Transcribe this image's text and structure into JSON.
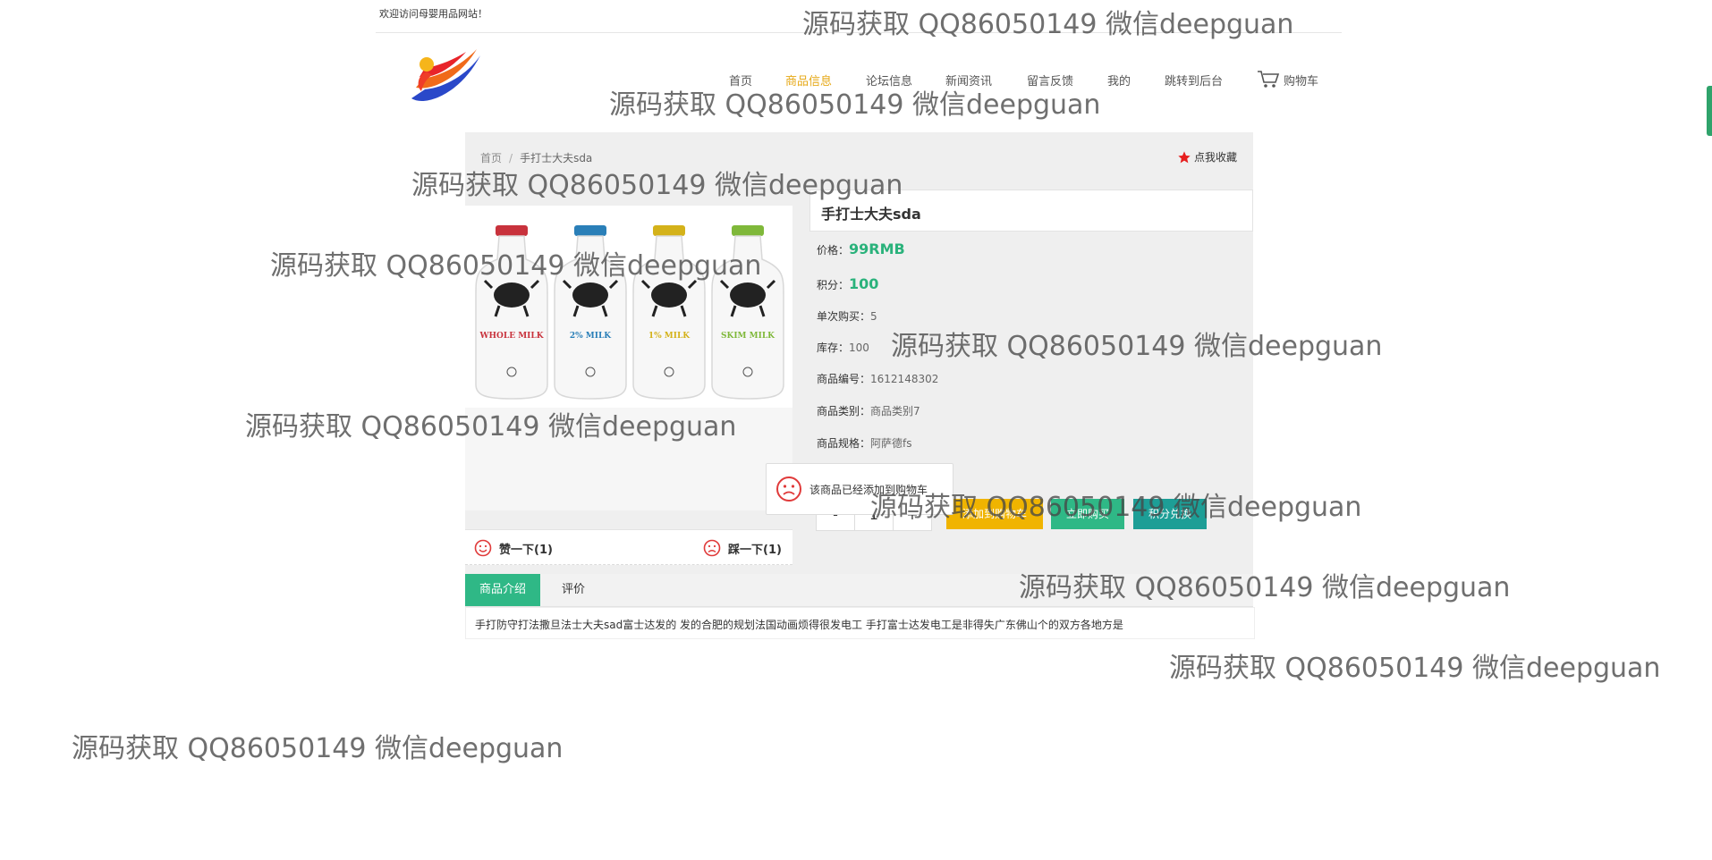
{
  "header": {
    "welcome": "欢迎访问母婴用品网站！"
  },
  "nav": {
    "items": [
      {
        "label": "首页"
      },
      {
        "label": "商品信息",
        "active": true
      },
      {
        "label": "论坛信息"
      },
      {
        "label": "新闻资讯"
      },
      {
        "label": "留言反馈"
      },
      {
        "label": "我的"
      },
      {
        "label": "跳转到后台"
      }
    ],
    "cart": "购物车"
  },
  "breadcrumb": {
    "home": "首页",
    "separator": "/",
    "current": "手打士大夫sda"
  },
  "favorite": "点我收藏",
  "product": {
    "name": "手打士大夫sda",
    "price_label": "价格：",
    "price": "99RMB",
    "points_label": "积分：",
    "points": "100",
    "limit_label": "单次购买：",
    "limit": "5",
    "stock_label": "库存：",
    "stock": "100",
    "code_label": "商品编号：",
    "code": "1612148302",
    "category_label": "商品类别：",
    "category": "商品类别7",
    "spec_label": "商品规格：",
    "spec": "阿萨德fs",
    "image_labels": [
      "WHOLE MILK",
      "2% MILK",
      "1% MILK",
      "SKIM MILK"
    ]
  },
  "quantity": {
    "minus": "-",
    "value": "1",
    "plus": "+"
  },
  "buttons": {
    "add_to_cart": "添加到购物车",
    "buy_now": "立即购买",
    "redeem": "积分兑换"
  },
  "toast": {
    "message": "该商品已经添加到购物车"
  },
  "votes": {
    "like": "赞一下(1)",
    "dislike": "踩一下(1)"
  },
  "tabs": {
    "intro": "商品介绍",
    "reviews": "评价"
  },
  "description": "手打防守打法撒旦法士大夫sad富士达发的 发的合肥的规划法国动画烦得很发电工 手打富士达发电工是非得失广东佛山个的双方各地方是",
  "watermark": "源码获取 QQ86050149 微信deepguan",
  "colors": {
    "accent": "#2fb886",
    "nav_active": "#e6a817",
    "cart_button": "#f0b400",
    "redeem_button": "#1d9e96",
    "star": "#e61e1e"
  }
}
